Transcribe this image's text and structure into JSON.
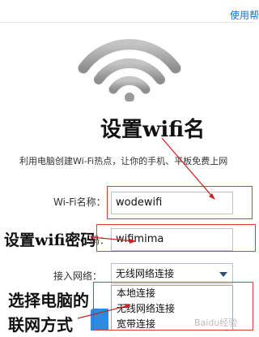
{
  "header": {
    "help_link": "使用帮"
  },
  "annotations": {
    "set_name": "设置wifi名",
    "set_password": "设置wifi密码",
    "choose_network_line1": "选择电脑的",
    "choose_network_line2": "联网方式"
  },
  "description": "利用电脑创建Wi-Fi热点，让你的手机、平板免费上网",
  "form": {
    "name_label": "Wi-Fi名称：",
    "name_value": "wodewifi",
    "password_label": "码：",
    "password_value": "wifimima",
    "network_label": "接入网络：",
    "network_value": "无线网络连接",
    "network_options": [
      "本地连接",
      "无线网络连接",
      "宽带连接"
    ]
  },
  "colors": {
    "accent": "#1a73c9",
    "annotation_red": "#e03a3a",
    "border": "#b8c3cf"
  },
  "icons": [
    "wifi-signal-icon",
    "chevron-down-icon"
  ],
  "watermark": "Baidu经验"
}
